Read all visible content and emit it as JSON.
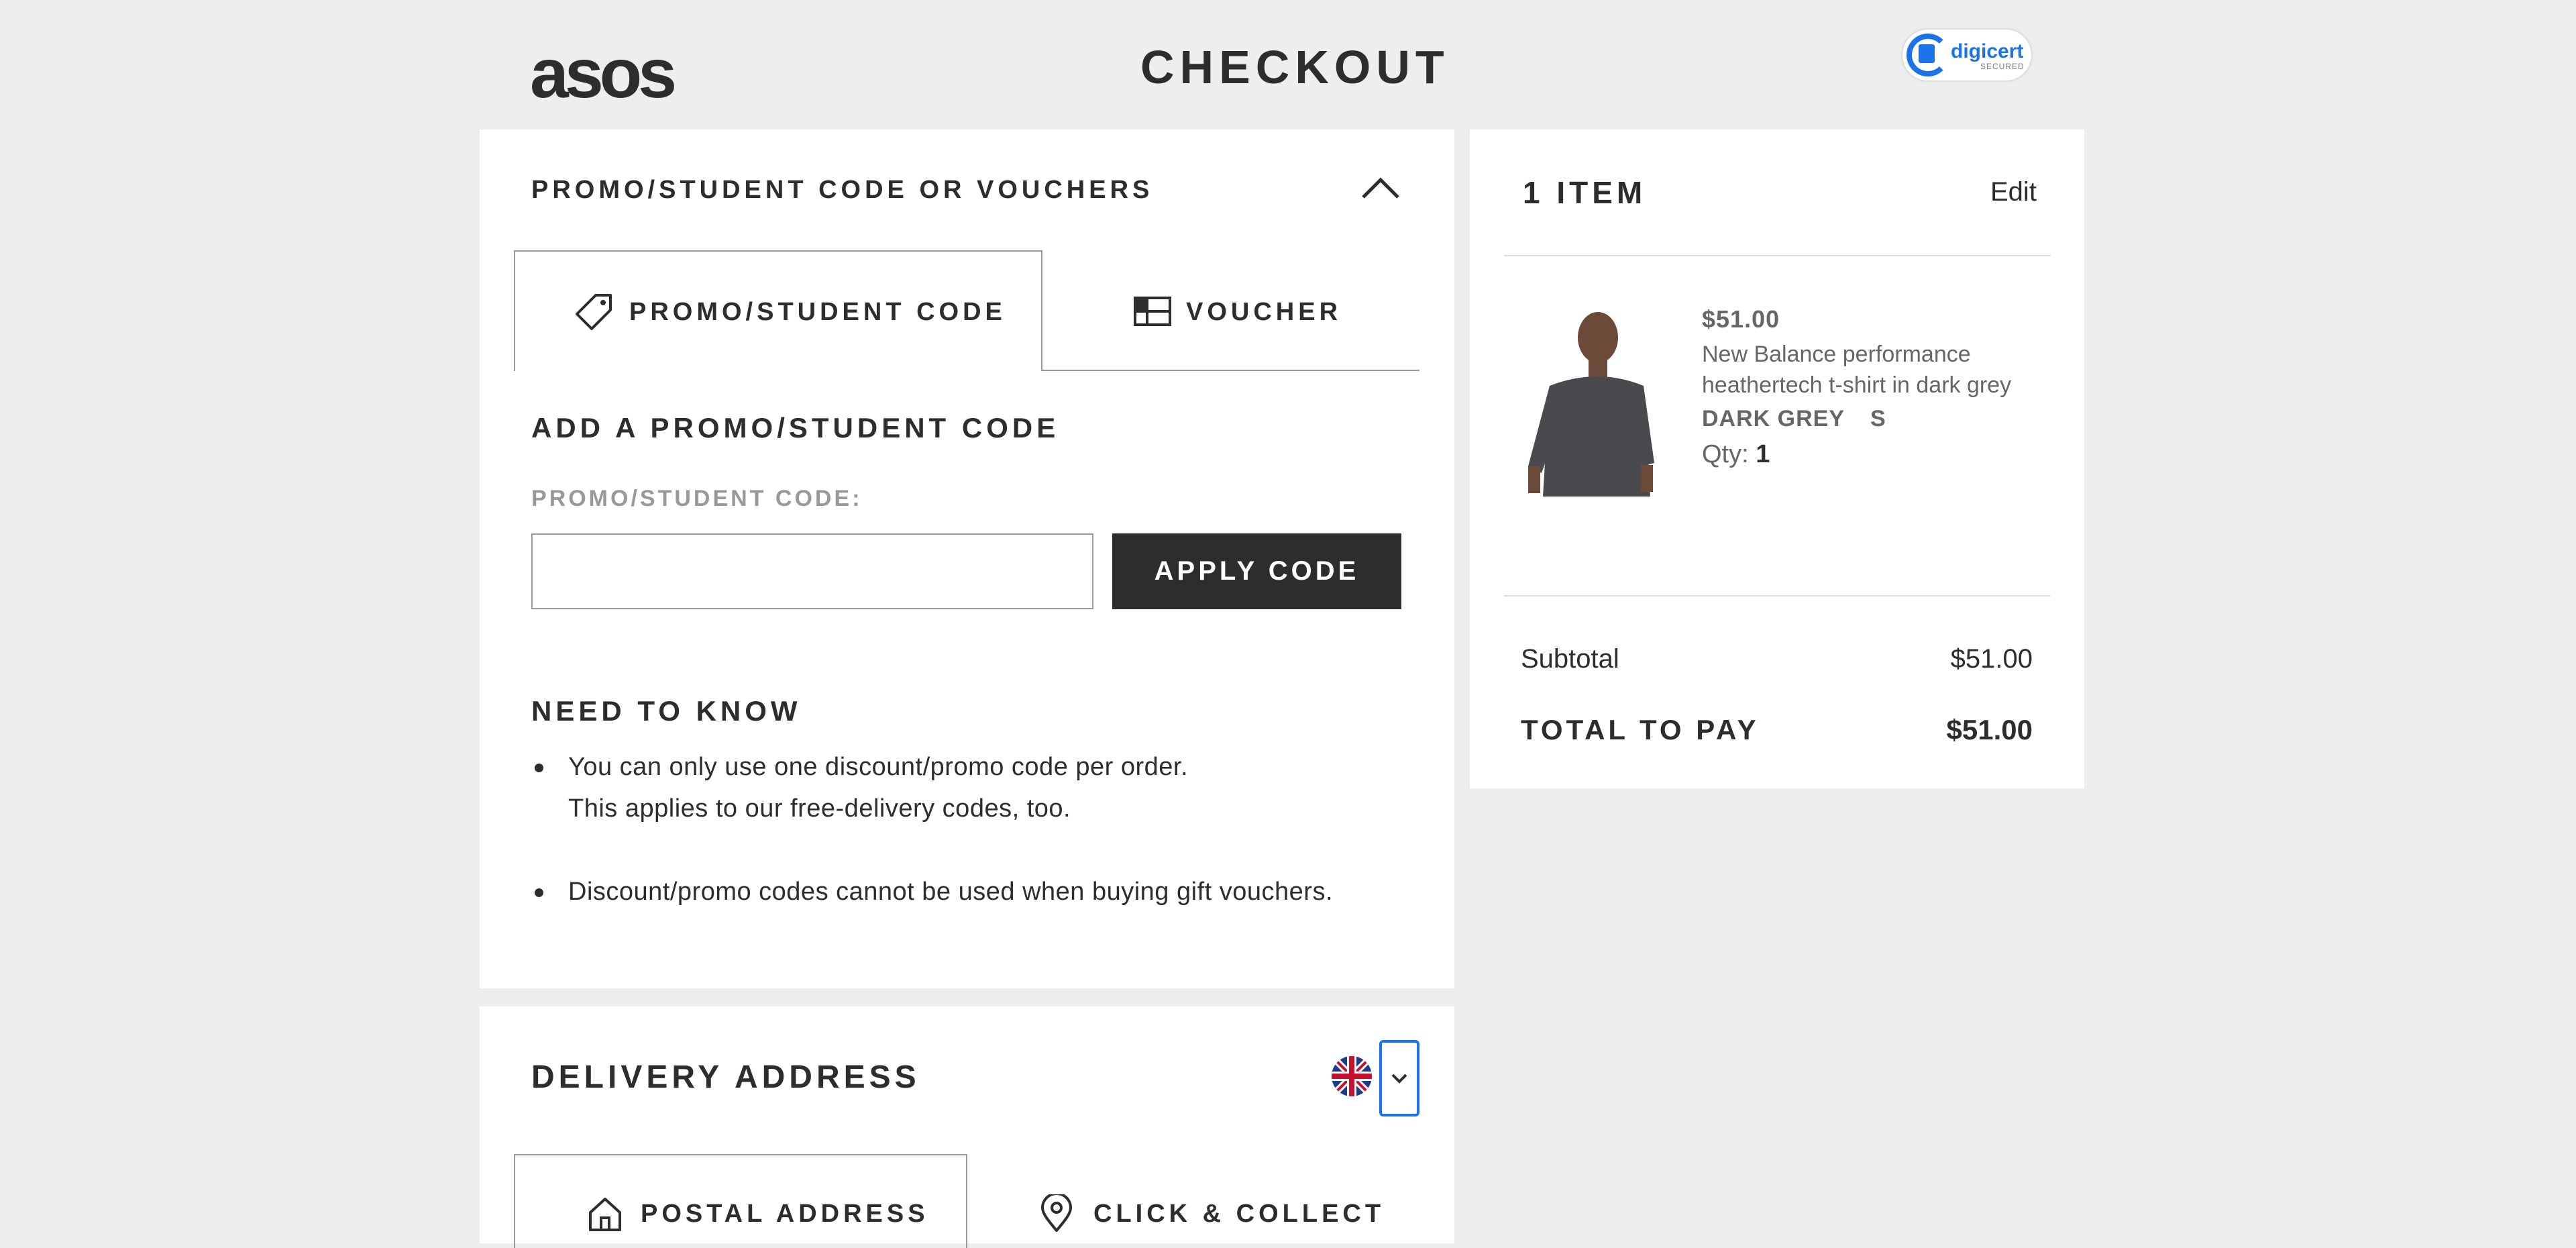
{
  "header": {
    "logo": "asos",
    "title": "CHECKOUT",
    "trust_badge": {
      "name": "digicert",
      "sub": "SECURED"
    }
  },
  "promo": {
    "heading": "PROMO/STUDENT CODE OR VOUCHERS",
    "tabs": [
      {
        "label": "PROMO/STUDENT CODE",
        "icon": "tag-icon",
        "active": true
      },
      {
        "label": "VOUCHER",
        "icon": "voucher-icon",
        "active": false
      }
    ],
    "add_heading": "ADD A PROMO/STUDENT CODE",
    "field_label": "PROMO/STUDENT CODE:",
    "input_value": "",
    "apply_label": "APPLY CODE",
    "need_to_know_heading": "NEED TO KNOW",
    "notes": [
      [
        "You can only use one discount/promo code per order.",
        "This applies to our free-delivery codes, too."
      ],
      [
        "Discount/promo codes cannot be used when buying gift vouchers."
      ]
    ]
  },
  "summary": {
    "heading": "1 ITEM",
    "edit_label": "Edit",
    "item": {
      "price": "$51.00",
      "name_line1": "New Balance performance",
      "name_line2": "heathertech t-shirt in dark grey",
      "colour": "DARK GREY",
      "size": "S",
      "qty_label": "Qty:",
      "qty": "1"
    },
    "subtotal_label": "Subtotal",
    "subtotal_value": "$51.00",
    "total_label": "TOTAL TO PAY",
    "total_value": "$51.00"
  },
  "delivery": {
    "heading": "DELIVERY ADDRESS",
    "country_flag": "uk-flag-icon",
    "tabs": [
      {
        "label": "POSTAL ADDRESS",
        "icon": "home-icon",
        "active": true
      },
      {
        "label": "CLICK & COLLECT",
        "icon": "location-pin-icon",
        "active": false
      }
    ]
  },
  "colors": {
    "background": "#eeeeee",
    "text": "#2d2d2d",
    "muted": "#666666",
    "button": "#2d2d2d",
    "focus": "#1a73e8"
  }
}
